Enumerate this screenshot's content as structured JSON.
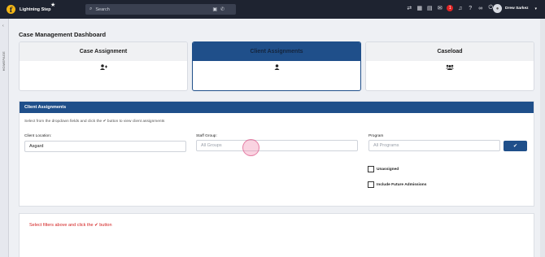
{
  "app": {
    "brand_letter": "f",
    "brand_name": "Lightning Step",
    "favorite_icon": "star-icon"
  },
  "search": {
    "placeholder": "Search"
  },
  "header": {
    "icons": [
      "exchange-icon",
      "calendar-icon",
      "id-card-icon",
      "chat-icon",
      "bell-icon",
      "help-icon",
      "link-icon",
      "power-icon"
    ],
    "chat_badge": "1",
    "user_name": "Drew Sarkez"
  },
  "rail": {
    "label": "HOMEPAGE"
  },
  "page": {
    "title": "Case Management Dashboard"
  },
  "cards": [
    {
      "title": "Case Assignment",
      "icon": "user-plus-icon",
      "active": false
    },
    {
      "title": "Client Assignments",
      "icon": "user-icon",
      "active": true
    },
    {
      "title": "Caseload",
      "icon": "users-icon",
      "active": false
    }
  ],
  "panel": {
    "title": "Client Assignments",
    "instructions_pre": "Select from the dropdown fields and click the",
    "instructions_post": "button to view client assignments",
    "client_location_label": "Client Location:",
    "client_location_value": "Asgard",
    "staff_group_label": "Staff Group:",
    "staff_group_placeholder": "All Groups",
    "program_label": "Program",
    "program_placeholder": "All Programs",
    "unassigned_label": "Unassigned",
    "future_label": "Include Future Admissions"
  },
  "results": {
    "message_pre": "Select filters above and click the",
    "message_post": "button"
  },
  "colors": {
    "navbar": "#1e2330",
    "accent": "#1f4f8a",
    "badge": "#e02424",
    "error": "#d32020"
  }
}
